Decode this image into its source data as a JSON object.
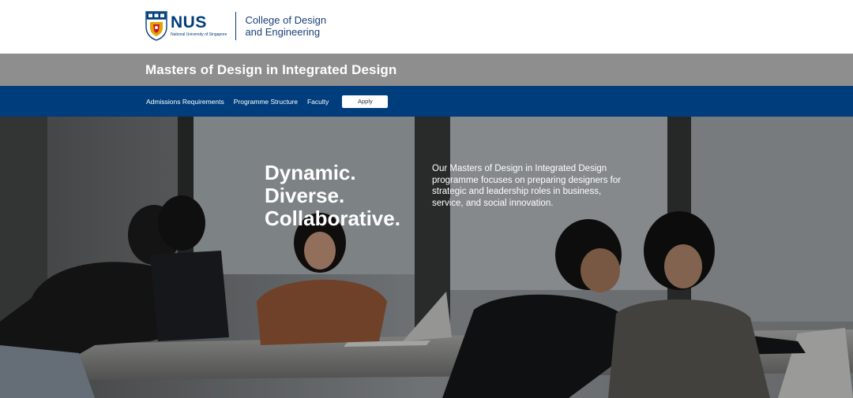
{
  "header": {
    "logo_wordmark": "NUS",
    "logo_subtext": "National University of Singapore",
    "college_name": "College of Design and Engineering"
  },
  "title_bar": {
    "programme_title": "Masters of Design in Integrated Design"
  },
  "nav": {
    "items": [
      {
        "label": "Admissions Requirements"
      },
      {
        "label": "Programme Structure"
      },
      {
        "label": "Faculty"
      }
    ],
    "apply_label": "Apply"
  },
  "hero": {
    "headline": [
      "Dynamic.",
      "Diverse.",
      "Collaborative."
    ],
    "description": "Our Masters of Design in Integrated Design programme focuses on preparing designers for strategic and leadership roles in business, service, and social innovation."
  },
  "colors": {
    "brand_blue": "#003d7c",
    "title_bar_grey": "#8e8e8e",
    "white": "#ffffff"
  },
  "icons": {
    "crest": "nus-crest-icon"
  }
}
